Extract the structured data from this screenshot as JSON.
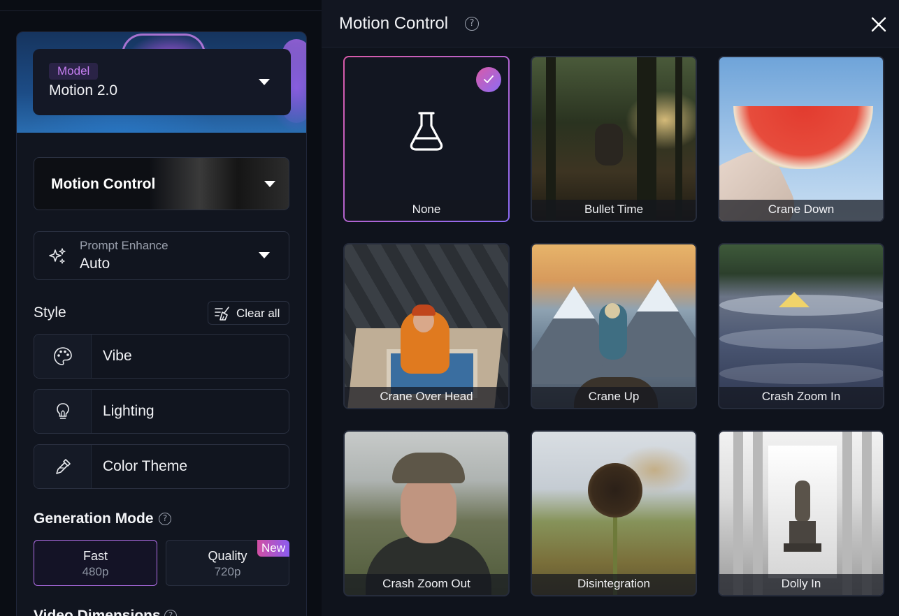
{
  "model": {
    "tag": "Model",
    "value": "Motion 2.0"
  },
  "motion_control_select": {
    "label": "Motion Control"
  },
  "prompt_enhance": {
    "label": "Prompt Enhance",
    "value": "Auto"
  },
  "style": {
    "title": "Style",
    "clear_label": "Clear all",
    "options": [
      {
        "label": "Vibe",
        "icon": "palette-icon"
      },
      {
        "label": "Lighting",
        "icon": "lightbulb-icon"
      },
      {
        "label": "Color Theme",
        "icon": "eyedropper-icon"
      }
    ]
  },
  "generation_mode": {
    "title": "Generation Mode",
    "modes": [
      {
        "name": "Fast",
        "resolution": "480p",
        "selected": true
      },
      {
        "name": "Quality",
        "resolution": "720p",
        "badge": "New"
      }
    ]
  },
  "video_dimensions": {
    "title": "Video Dimensions"
  },
  "drawer": {
    "title": "Motion Control",
    "options": [
      {
        "label": "None",
        "selected": true
      },
      {
        "label": "Bullet Time"
      },
      {
        "label": "Crane Down"
      },
      {
        "label": "Crane Over Head"
      },
      {
        "label": "Crane Up"
      },
      {
        "label": "Crash Zoom In"
      },
      {
        "label": "Crash Zoom Out"
      },
      {
        "label": "Disintegration"
      },
      {
        "label": "Dolly In"
      }
    ]
  },
  "colors": {
    "accent_pink": "#d95aa8",
    "accent_purple": "#8b6cf5",
    "background": "#0f131c"
  }
}
